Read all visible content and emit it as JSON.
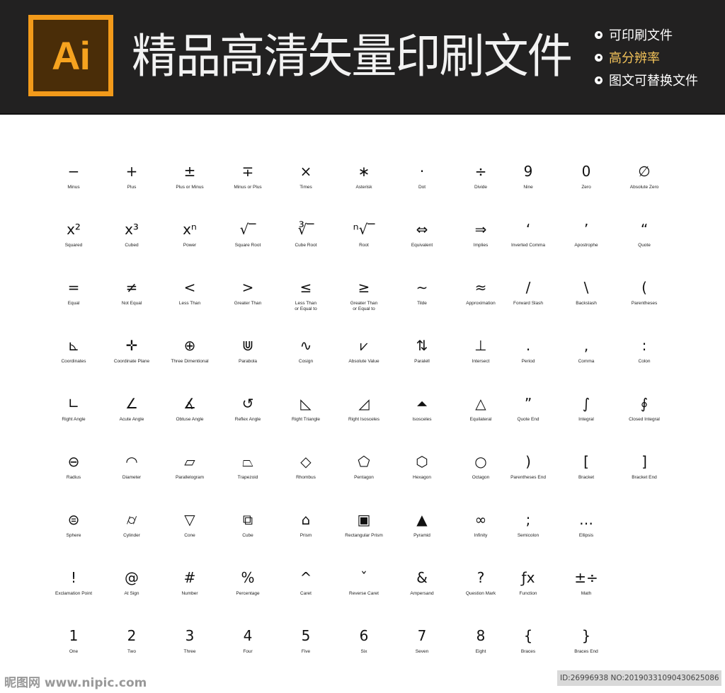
{
  "banner": {
    "logo_text": "Ai",
    "title": "精品高清矢量印刷文件",
    "features": [
      "可印刷文件",
      "高分辨率",
      "图文可替换文件"
    ],
    "accent_color": "#f3c35a",
    "logo_color": "#f29a1a"
  },
  "symbols": [
    [
      {
        "g": "−",
        "l": "Minus"
      },
      {
        "g": "+",
        "l": "Plus"
      },
      {
        "g": "±",
        "l": "Plus or Minus"
      },
      {
        "g": "∓",
        "l": "Minus or Plus"
      },
      {
        "g": "×",
        "l": "Times"
      },
      {
        "g": "∗",
        "l": "Asterisk"
      },
      {
        "g": "·",
        "l": "Dot"
      },
      {
        "g": "÷",
        "l": "Divide"
      },
      {
        "g": "9",
        "l": "Nine"
      },
      {
        "g": "0",
        "l": "Zero"
      },
      {
        "g": "∅",
        "l": "Absolute Zero"
      }
    ],
    [
      {
        "g": "x²",
        "l": "Squared"
      },
      {
        "g": "x³",
        "l": "Cubed"
      },
      {
        "g": "xⁿ",
        "l": "Power"
      },
      {
        "g": "√‾",
        "l": "Square Root"
      },
      {
        "g": "∛‾",
        "l": "Cube Root"
      },
      {
        "g": "ⁿ√‾",
        "l": "Root"
      },
      {
        "g": "⇔",
        "l": "Equivalent"
      },
      {
        "g": "⇒",
        "l": "Implies"
      },
      {
        "g": "‘",
        "l": "Inverted Comma"
      },
      {
        "g": "’",
        "l": "Apostrophe"
      },
      {
        "g": "“",
        "l": "Quote"
      }
    ],
    [
      {
        "g": "=",
        "l": "Equal"
      },
      {
        "g": "≠",
        "l": "Not Equal"
      },
      {
        "g": "<",
        "l": "Less Than"
      },
      {
        "g": ">",
        "l": "Greater Than"
      },
      {
        "g": "≤",
        "l": "Less Than\nor Equal to"
      },
      {
        "g": "≥",
        "l": "Greater Than\nor Equal to"
      },
      {
        "g": "∼",
        "l": "Tilde"
      },
      {
        "g": "≈",
        "l": "Approximation"
      },
      {
        "g": "/",
        "l": "Forward Slash"
      },
      {
        "g": "\\",
        "l": "Backslash"
      },
      {
        "g": "(",
        "l": "Parentheses"
      }
    ],
    [
      {
        "g": "⊾",
        "l": "Coordinates"
      },
      {
        "g": "✛",
        "l": "Coordinate Plane"
      },
      {
        "g": "⊕",
        "l": "Three Dimentional"
      },
      {
        "g": "⋓",
        "l": "Parabola"
      },
      {
        "g": "∿",
        "l": "Cosign"
      },
      {
        "g": "⩗",
        "l": "Absolute Value"
      },
      {
        "g": "⇅",
        "l": "Paralell"
      },
      {
        "g": "⊥",
        "l": "Intersect"
      },
      {
        "g": ".",
        "l": "Period"
      },
      {
        "g": ",",
        "l": "Comma"
      },
      {
        "g": ":",
        "l": "Colon"
      }
    ],
    [
      {
        "g": "∟",
        "l": "Right Angle"
      },
      {
        "g": "∠",
        "l": "Acute Angle"
      },
      {
        "g": "∡",
        "l": "Obtuse Angle"
      },
      {
        "g": "↺",
        "l": "Reflex Angle"
      },
      {
        "g": "◺",
        "l": "Right Triangle"
      },
      {
        "g": "◿",
        "l": "Right Isosceles"
      },
      {
        "g": "⏶",
        "l": "Isosceles"
      },
      {
        "g": "△",
        "l": "Equilateral"
      },
      {
        "g": "”",
        "l": "Quote End"
      },
      {
        "g": "∫",
        "l": "Integral"
      },
      {
        "g": "∮",
        "l": "Closed Integral"
      }
    ],
    [
      {
        "g": "⊖",
        "l": "Radius"
      },
      {
        "g": "◠",
        "l": "Diameter"
      },
      {
        "g": "▱",
        "l": "Parallelogram"
      },
      {
        "g": "⏢",
        "l": "Trapezoid"
      },
      {
        "g": "◇",
        "l": "Rhombus"
      },
      {
        "g": "⬠",
        "l": "Pentagon"
      },
      {
        "g": "⬡",
        "l": "Hexagon"
      },
      {
        "g": "○",
        "l": "Octagon"
      },
      {
        "g": ")",
        "l": "Parentheses End"
      },
      {
        "g": "[",
        "l": "Bracket"
      },
      {
        "g": "]",
        "l": "Bracket End"
      }
    ],
    [
      {
        "g": "⊜",
        "l": "Sphere"
      },
      {
        "g": "⌭",
        "l": "Cylinder"
      },
      {
        "g": "▽",
        "l": "Cone"
      },
      {
        "g": "⧉",
        "l": "Cube"
      },
      {
        "g": "⌂",
        "l": "Prism"
      },
      {
        "g": "▣",
        "l": "Rectangular Prism"
      },
      {
        "g": "▲",
        "l": "Pyramid"
      },
      {
        "g": "∞",
        "l": "Infinity"
      },
      {
        "g": ";",
        "l": "Semicolon"
      },
      {
        "g": "…",
        "l": "Ellipsis"
      }
    ],
    [
      {
        "g": "!",
        "l": "Exclamation Point"
      },
      {
        "g": "@",
        "l": "At Sign"
      },
      {
        "g": "#",
        "l": "Number"
      },
      {
        "g": "%",
        "l": "Percentage"
      },
      {
        "g": "^",
        "l": "Caret"
      },
      {
        "g": "ˇ",
        "l": "Reverse Caret"
      },
      {
        "g": "&",
        "l": "Ampersand"
      },
      {
        "g": "?",
        "l": "Question Mark"
      },
      {
        "g": "ƒx",
        "l": "Function"
      },
      {
        "g": "±÷",
        "l": "Math"
      }
    ],
    [
      {
        "g": "1",
        "l": "One"
      },
      {
        "g": "2",
        "l": "Two"
      },
      {
        "g": "3",
        "l": "Three"
      },
      {
        "g": "4",
        "l": "Four"
      },
      {
        "g": "5",
        "l": "Five"
      },
      {
        "g": "6",
        "l": "Six"
      },
      {
        "g": "7",
        "l": "Seven"
      },
      {
        "g": "8",
        "l": "Eight"
      },
      {
        "g": "{",
        "l": "Braces"
      },
      {
        "g": "}",
        "l": "Braces End"
      }
    ]
  ],
  "watermark": "昵图网 www.nipic.com",
  "image_id": "ID:26996938 NO:20190331090430625086"
}
